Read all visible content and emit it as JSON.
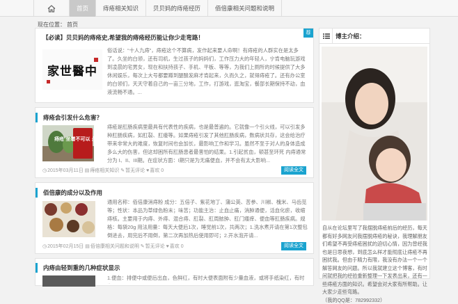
{
  "nav": {
    "home_icon": "home-icon",
    "items": [
      {
        "label": "首页",
        "active": true
      },
      {
        "label": "痔疮相关知识"
      },
      {
        "label": "贝贝妈的痔疮经历"
      },
      {
        "label": "佰倍康相关问题和说明"
      }
    ]
  },
  "breadcrumb": {
    "prefix": "现在位置：",
    "current": "首页"
  },
  "posts": [
    {
      "title": "【必读】贝贝妈的痔疮史,希望我的痔疮经历能让你少走弯路！",
      "pin_label": "荐",
      "thumb_text": "家世醫中",
      "excerpt": "俗话说：“十人九痔”，痔疮这个不算病，发作起来要人命啊！有痔疮的人群实在是太多了。久坐的白领，还有司机，生过孩子的妈妈们，工作压力大的年轻人，宁肯电脑玩游戏到凌晨的宅男女，现在和扶持孩子、手机、平板、等等，为我们上厕所的时候提供了大多休闲娱乐，每次上大号都要蹲到腿酸发麻才肯起来，久而久之，就得痔疮了。还有办公室的白领们，天天守着自己的一亩三分地，工作，打游戏，逛淘宝，餐部长期保持不动，血液流畅不通。..."
    },
    {
      "title": "痔疮会引发什么危害？",
      "thumb_text": "痔疮 坐着不可以 永远之苦",
      "excerpt": "痔疮是肛肠疾病里最具有代表性的疾病，也是最普遍的。它就像一个引火线，可以引发多种肛肠疾病，如肛裂、肛瘘等。如果痔疮引发了其他肛肠疾病，数病状共存，这会给治疗带来非常大的难度，恢复时间也会加长，最影响工作和学习。虽然不至于对人的身体造成多么大的伤害，但这却困所有肛肠患者最害怕的结果。1.引起贫血，顿甚至环死 内痔通常分为 I、II、III期。在症状方面：Ⅰ期只是为无痛便血，并不会有太大影响...",
      "date": "2015年03月11日",
      "category": "痔疮相关知识",
      "comments": "暂无评论",
      "likes": "喜欢 0",
      "read_more": "阅读全文"
    },
    {
      "title": "佰倍康的成分以及作用",
      "excerpt": "通用名称：佰倍康消痔粉 成分：五倍子、紫花地丁、蒲公英、苦参、川椒、槐米、马齿苋等；性状：本品为草绿色粉末；味苦；功能主治：止血止痛，消肿通便，活血化瘀，收缩痔核。主要用于内痔、外痔、混合痔、肛裂、肛周脓肿、肛门瘙痒、便血等肛肠疾病。规格：每袋20g 用法用量：每天大便后1次，睡觉前1次，共两次；1.洗水煮开请在第1次整包倒进去，用完后不用倒，第二次再加热后使用即可；2.开水泡开请...",
      "date": "2015年02月15日",
      "category": "佰倍康相关问题和说明",
      "comments": "暂无评论",
      "likes": "喜欢 0",
      "read_more": "阅读全文"
    },
    {
      "title": "内痔由轻到重的几种症状显示",
      "excerpt": "1.便血：排便中或便后出血，色鲜红，有时大便表面附有少量血液，或将手纸染红，有时为"
    }
  ],
  "sidebar": {
    "title": "博主介绍：",
    "bio": "自从在论坛里写了我摆脱痔疮前后的经历，每天都有好多网友问我摆脱痔疮的秘诀，我理解朋友们希望不再受痔疮困扰的迫切心情，因为曾经我也是日思夜想，到底怎么样才能彻底让痔疮不再困扰我。但由于精力有限，我没有办法一个一个解答网友的问题。所以我就建立这个博客，有时间就把我的经验重新整理一下发表出来，还有一些痔疮方面的知识。希望会对大家有所帮助。让大家少走些弯路。",
    "qq": "（我的QQ是：782992332）"
  },
  "colors": {
    "accent": "#1aa3cf"
  }
}
